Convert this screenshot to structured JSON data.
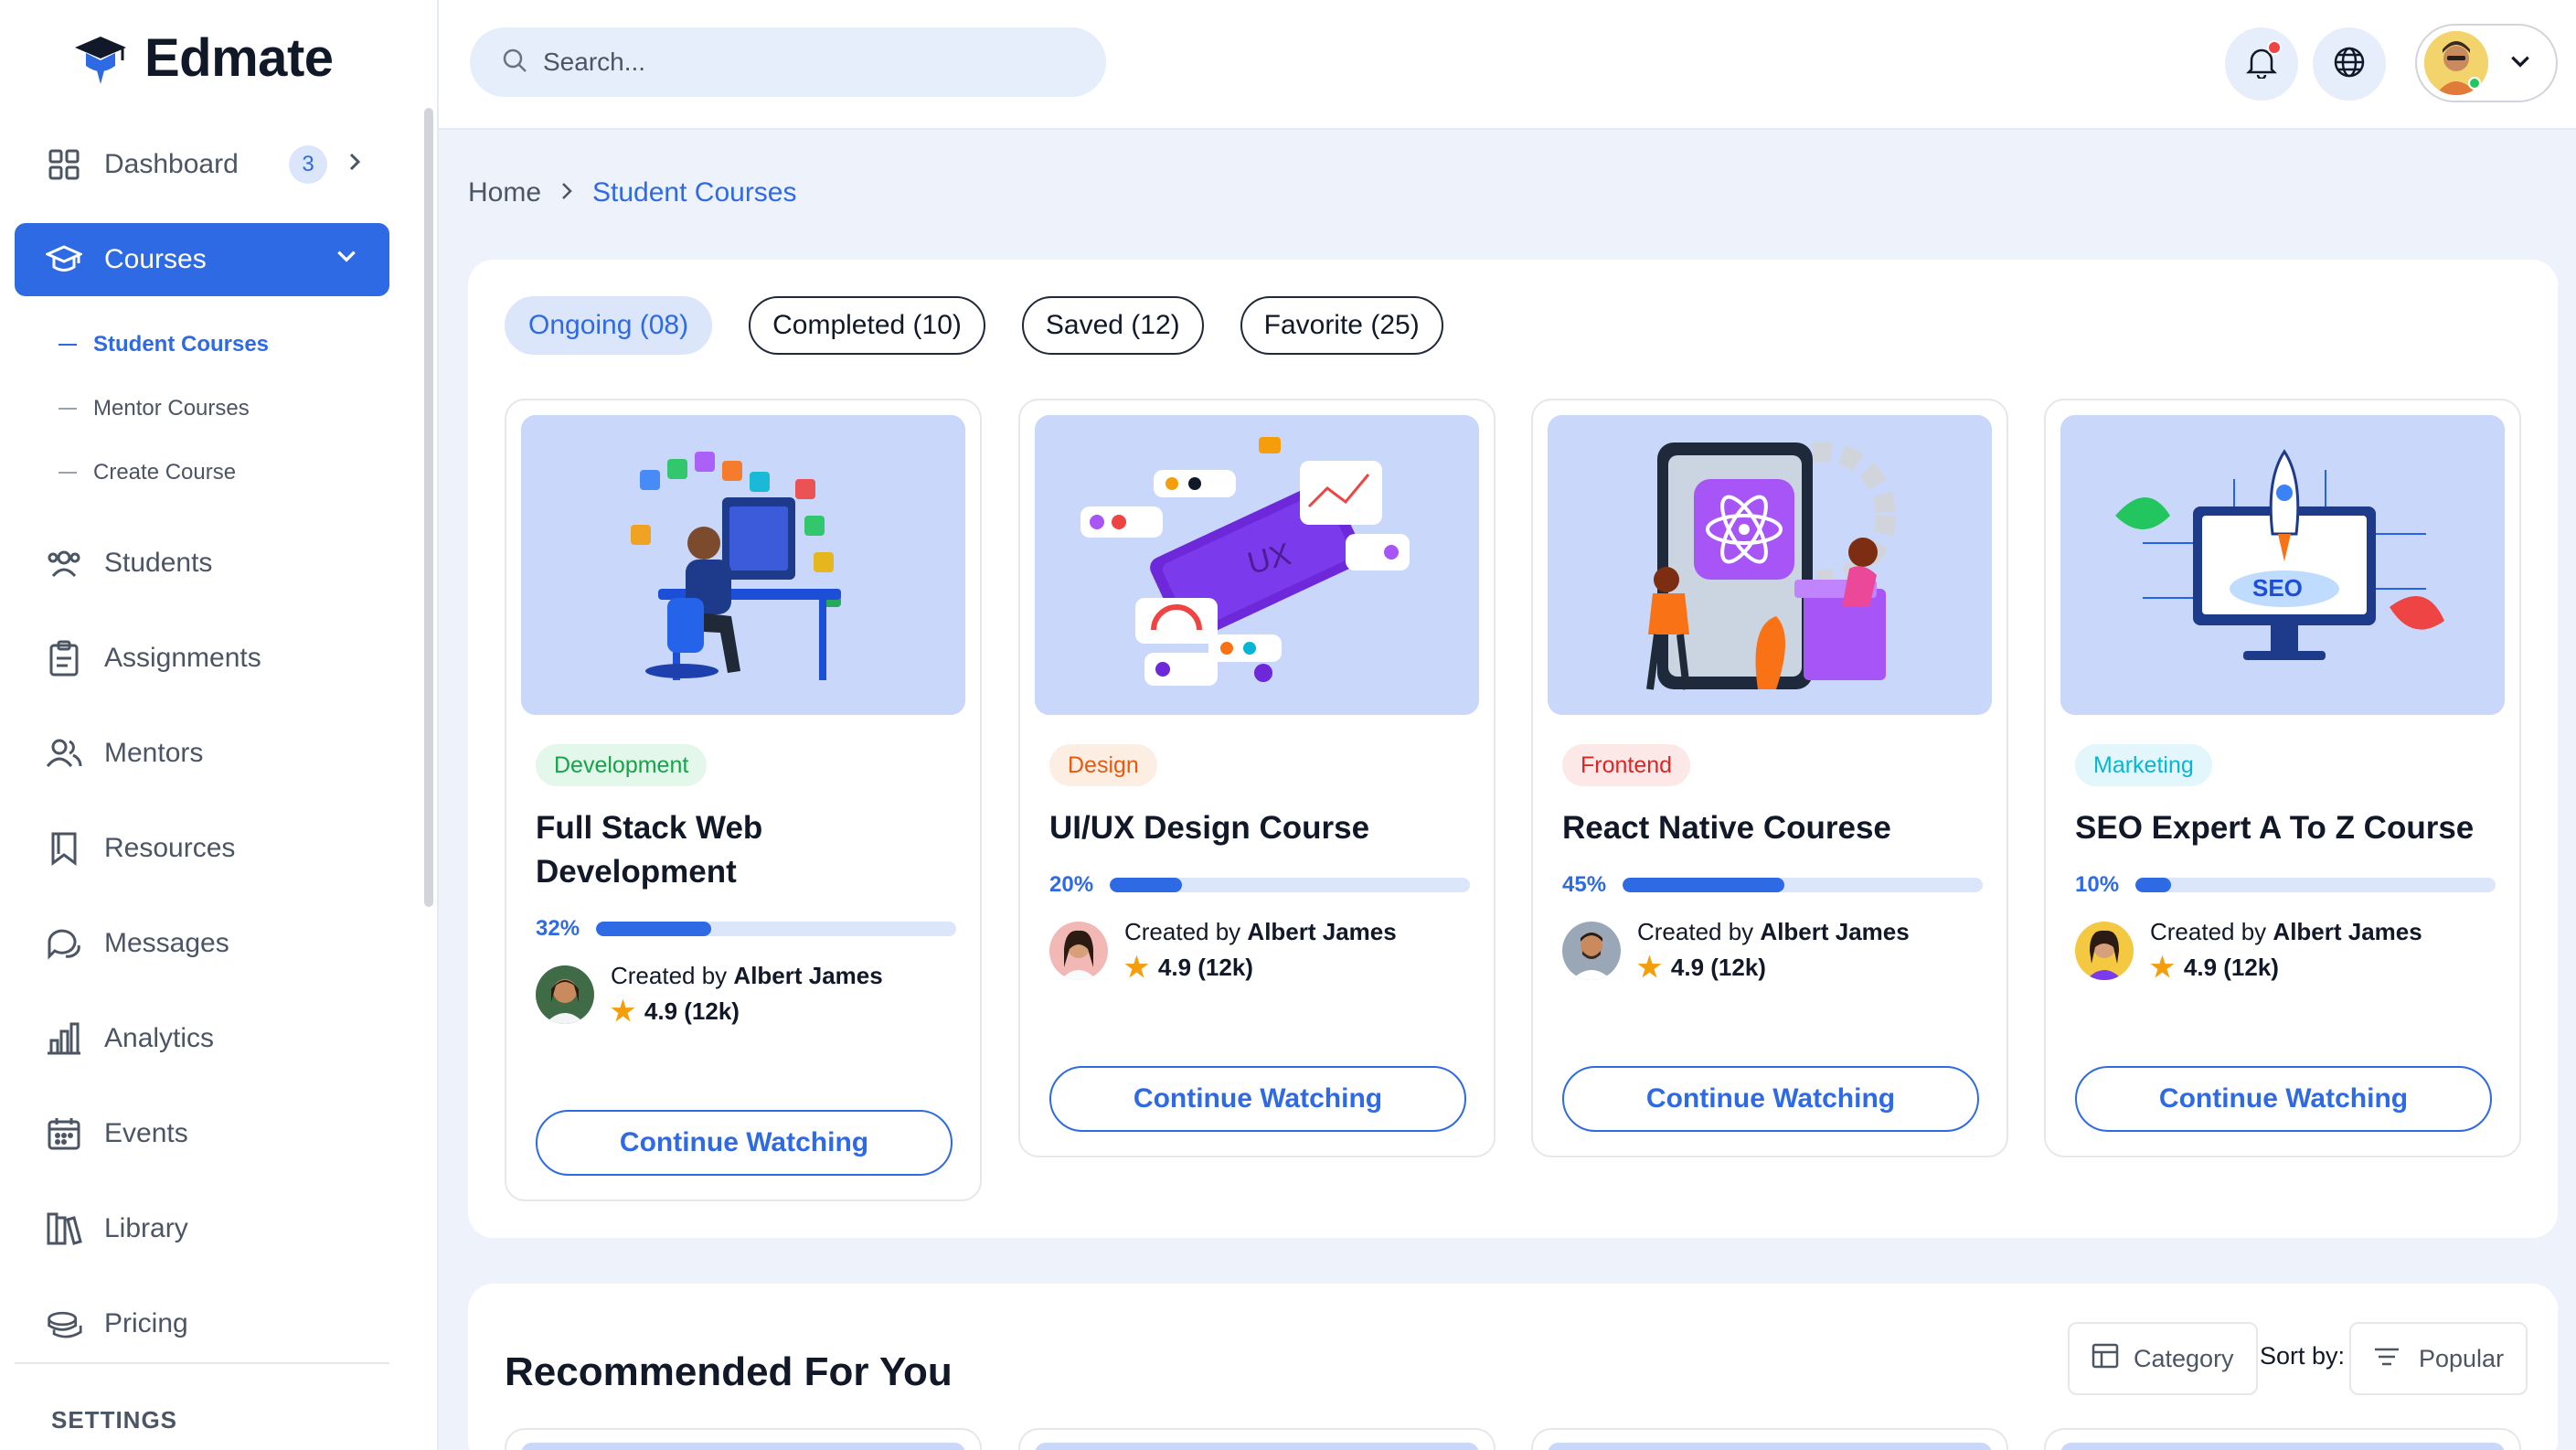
{
  "brand": {
    "name": "Edmate",
    "accent": "#2f6ae5"
  },
  "search": {
    "placeholder": "Search..."
  },
  "sidebar": {
    "items": [
      {
        "label": "Dashboard",
        "badge": "3",
        "icon": "grid-icon"
      },
      {
        "label": "Courses",
        "icon": "graduation-cap-icon",
        "active": true
      },
      {
        "label": "Students",
        "icon": "users-icon"
      },
      {
        "label": "Assignments",
        "icon": "clipboard-icon"
      },
      {
        "label": "Mentors",
        "icon": "user-group-icon"
      },
      {
        "label": "Resources",
        "icon": "bookmark-icon"
      },
      {
        "label": "Messages",
        "icon": "chat-icon"
      },
      {
        "label": "Analytics",
        "icon": "bar-chart-icon"
      },
      {
        "label": "Events",
        "icon": "calendar-icon"
      },
      {
        "label": "Library",
        "icon": "books-icon"
      },
      {
        "label": "Pricing",
        "icon": "coins-icon"
      }
    ],
    "subitems": [
      {
        "label": "Student Courses",
        "active": true
      },
      {
        "label": "Mentor Courses"
      },
      {
        "label": "Create Course"
      }
    ],
    "settings_title": "SETTINGS"
  },
  "breadcrumb": {
    "home": "Home",
    "current": "Student Courses"
  },
  "tabs": [
    {
      "label": "Ongoing (08)",
      "active": true
    },
    {
      "label": "Completed (10)"
    },
    {
      "label": "Saved (12)"
    },
    {
      "label": "Favorite (25)"
    }
  ],
  "courses": [
    {
      "tag": "Development",
      "tag_color": "#16a34a",
      "tag_bg": "#e3f7ea",
      "title": "Full Stack Web Development",
      "progress": 32,
      "progress_label": "32%",
      "created_by": "Created by",
      "author": "Albert James",
      "rating": "4.9 (12k)",
      "cta": "Continue Watching"
    },
    {
      "tag": "Design",
      "tag_color": "#ea580c",
      "tag_bg": "#fdeee4",
      "title": "UI/UX Design Course",
      "progress": 20,
      "progress_label": "20%",
      "created_by": "Created by",
      "author": "Albert James",
      "rating": "4.9 (12k)",
      "cta": "Continue Watching"
    },
    {
      "tag": "Frontend",
      "tag_color": "#dc2626",
      "tag_bg": "#fde8e8",
      "title": "React Native Courese",
      "progress": 45,
      "progress_label": "45%",
      "created_by": "Created by",
      "author": "Albert James",
      "rating": "4.9 (12k)",
      "cta": "Continue Watching"
    },
    {
      "tag": "Marketing",
      "tag_color": "#06b6d4",
      "tag_bg": "#e2f6fb",
      "title": "SEO Expert A To Z Course",
      "progress": 10,
      "progress_label": "10%",
      "created_by": "Created by",
      "author": "Albert James",
      "rating": "4.9 (12k)",
      "cta": "Continue Watching"
    }
  ],
  "recommended": {
    "title": "Recommended For You",
    "category_label": "Category",
    "sort_label": "Sort by:",
    "sort_value": "Popular"
  }
}
